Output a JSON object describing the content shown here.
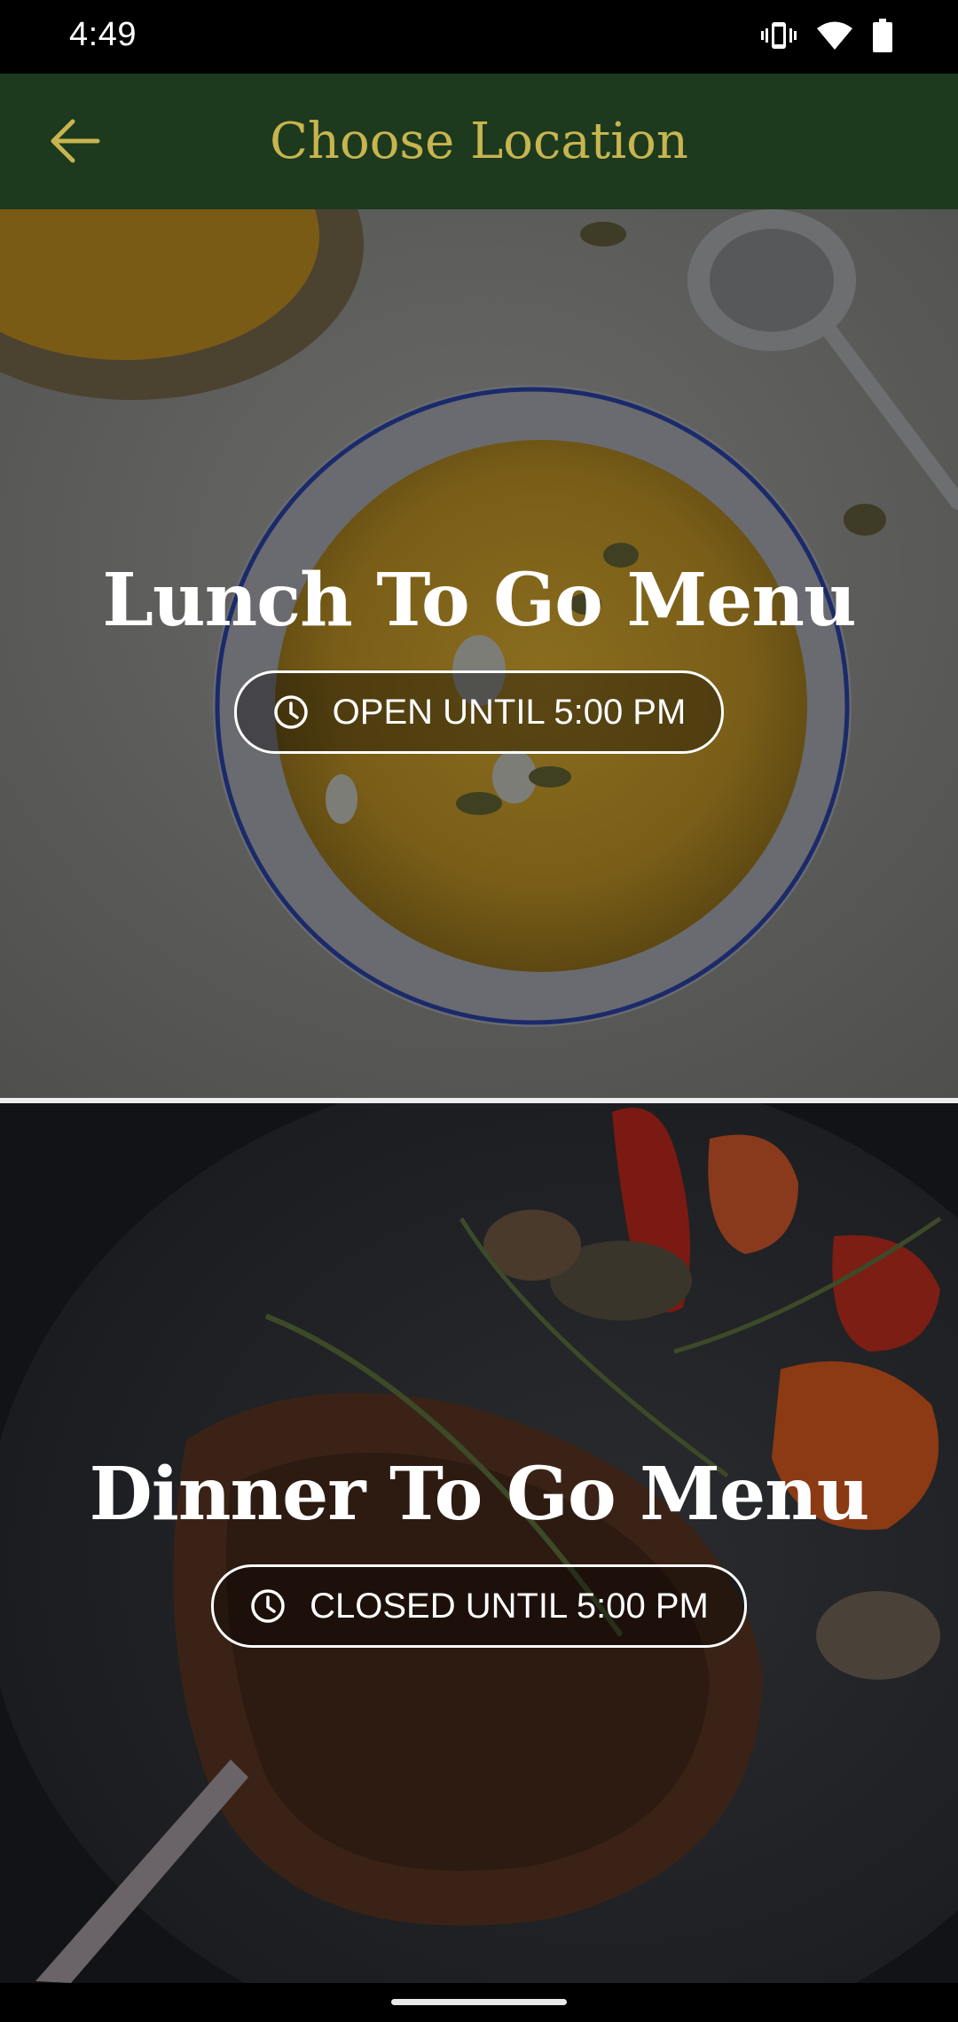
{
  "status_bar": {
    "time": "4:49",
    "icons": [
      "vibrate-icon",
      "wifi-icon",
      "battery-icon"
    ]
  },
  "app_bar": {
    "title": "Choose Location",
    "back_icon": "arrow-left-icon",
    "background_color": "#1d3a1f",
    "title_color": "#c8b54f"
  },
  "locations": [
    {
      "title": "Lunch To Go Menu",
      "status": "OPEN UNTIL 5:00 PM",
      "status_icon": "clock-icon",
      "background": "soup-bowl-photo"
    },
    {
      "title": "Dinner To Go Menu",
      "status": "CLOSED UNTIL 5:00 PM",
      "status_icon": "clock-icon",
      "background": "steak-vegetables-photo"
    }
  ]
}
